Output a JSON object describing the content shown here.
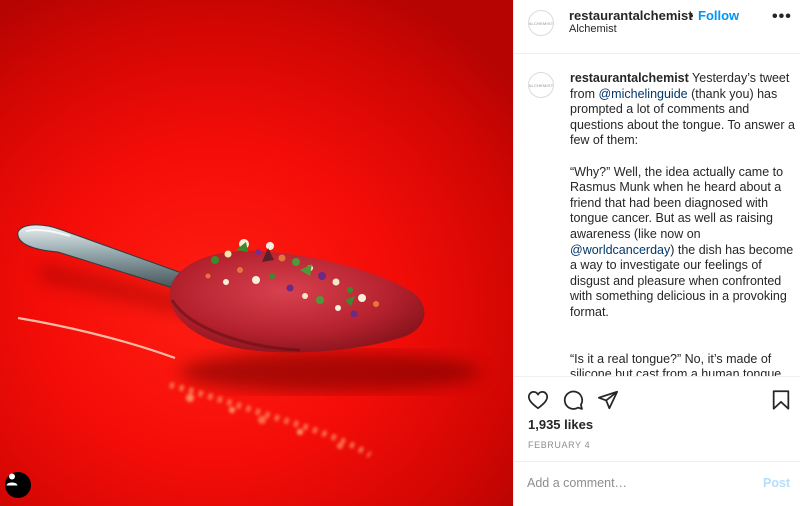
{
  "post": {
    "username": "restaurantalchemist",
    "follow_label": "Follow",
    "separator": "•",
    "location": "Alchemist",
    "more_label": "•••",
    "avatar_text": "ALCHEMIST"
  },
  "caption": {
    "username": "restaurantalchemist",
    "p1_text": " Yesterday’s tweet from ",
    "p1_mention": "@michelinguide",
    "p1_rest": " (thank you) has prompted a lot of comments and questions about the tongue. To answer a few of them:",
    "p2_text": "“Why?” Well, the idea actually came to Rasmus Munk when he heard about a friend that had been diagnosed with tongue cancer. But as well as raising awareness (like now on ",
    "p2_mention": "@worldcancerday",
    "p2_rest": ") the dish has become a way to investigate our feelings of disgust and pleasure when confronted with something delicious in a provoking format.",
    "p3_text": "“Is it a real tongue?” No, it’s made of silicone but cast from a human tongue."
  },
  "actions": {
    "likes": "1,935 likes",
    "date": "FEBRUARY 4",
    "icons": [
      "heart-icon",
      "comment-icon",
      "share-icon",
      "bookmark-icon"
    ]
  },
  "comment": {
    "placeholder": "Add a comment…",
    "post_label": "Post"
  },
  "colors": {
    "background_red": "#f40d08",
    "follow_blue": "#0095f6",
    "post_disabled": "#b2dffc",
    "mention": "#00376b"
  }
}
